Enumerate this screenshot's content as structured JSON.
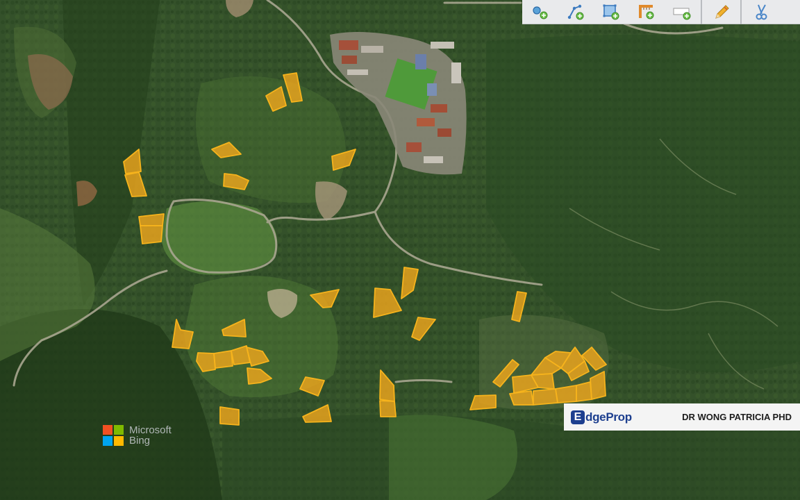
{
  "toolbar": {
    "tools": [
      {
        "name": "add-point-tool",
        "icon": "point-plus-icon"
      },
      {
        "name": "add-line-tool",
        "icon": "line-plus-icon"
      },
      {
        "name": "add-polygon-tool",
        "icon": "polygon-plus-icon"
      },
      {
        "name": "add-measure-tool",
        "icon": "measure-plus-icon"
      },
      {
        "name": "add-label-tool",
        "icon": "label-plus-icon"
      },
      {
        "name": "edit-tool",
        "icon": "pencil-icon"
      },
      {
        "name": "cut-tool",
        "icon": "scissors-icon"
      }
    ]
  },
  "map": {
    "plot_fill": "#f2a81d",
    "plot_stroke": "#f6b31c",
    "forest_color": "#2f4a22"
  },
  "attribution": {
    "provider_line1": "Microsoft",
    "provider_line2": "Bing",
    "logo_colors": [
      "#f25022",
      "#7fba00",
      "#00a4ef",
      "#ffb900"
    ]
  },
  "listing": {
    "brand_letter": "E",
    "brand_rest": "dgeProp",
    "brand_color": "#1d3f8f",
    "agent": "DR WONG PATRICIA PHD"
  }
}
